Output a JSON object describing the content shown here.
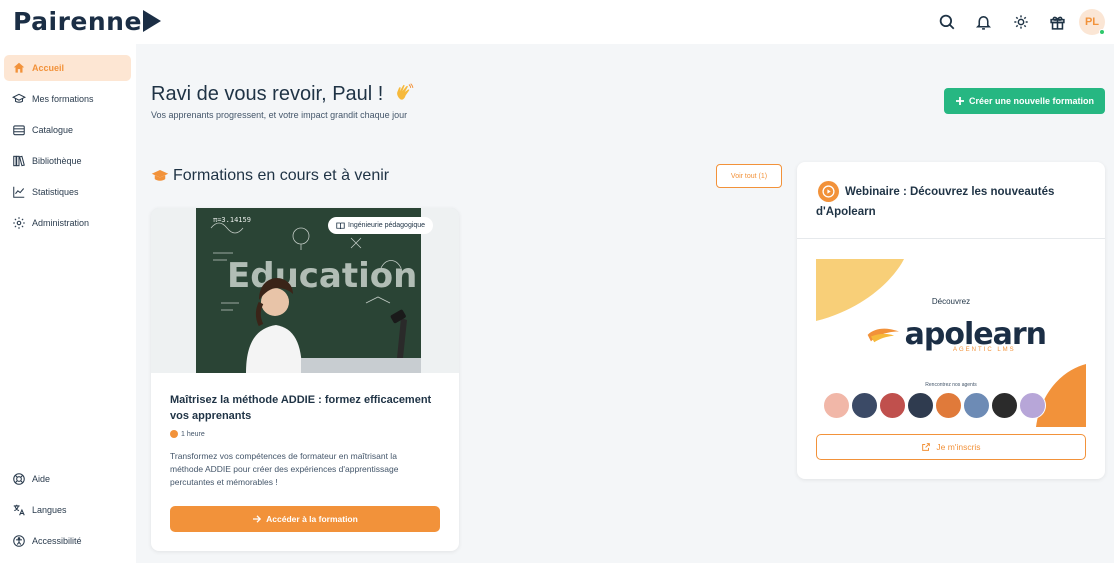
{
  "app": {
    "brand": "Pairenne"
  },
  "topbar": {
    "icons": [
      "search-icon",
      "bell-icon",
      "sun-icon",
      "gift-icon"
    ],
    "user_initials": "PL"
  },
  "sidebar": {
    "items": [
      {
        "label": "Accueil",
        "icon": "home-icon",
        "active": true
      },
      {
        "label": "Mes formations",
        "icon": "graduation-cap-icon"
      },
      {
        "label": "Catalogue",
        "icon": "catalog-icon"
      },
      {
        "label": "Bibliothèque",
        "icon": "library-icon"
      },
      {
        "label": "Statistiques",
        "icon": "chart-line-icon"
      },
      {
        "label": "Administration",
        "icon": "gear-icon"
      }
    ],
    "bottom_items": [
      {
        "label": "Aide",
        "icon": "help-icon"
      },
      {
        "label": "Langues",
        "icon": "language-icon"
      },
      {
        "label": "Accessibilité",
        "icon": "accessibility-icon"
      }
    ]
  },
  "header": {
    "welcome": "Ravi de vous revoir, Paul !",
    "subtitle": "Vos apprenants progressent, et votre impact grandit chaque jour",
    "create_button": "Créer une nouvelle formation"
  },
  "courses_section": {
    "title": "Formations en cours et à venir",
    "see_all": "Voir tout (1)",
    "course": {
      "badge": "Ingénieurie pédagogique",
      "image_text": "Education",
      "title": "Maîtrisez la méthode ADDIE : formez efficacement vos apprenants",
      "duration": "1 heure",
      "description": "Transformez vos compétences de formateur en maîtrisant la méthode ADDIE pour créer des expériences d'apprentissage percutantes et mémorables !",
      "button": "Accéder à la formation"
    }
  },
  "webinar": {
    "title": "Webinaire : Découvrez les nouveautés d'Apolearn",
    "promo": {
      "discover": "Découvrez",
      "brand": "apolearn",
      "tagline": "AGENTIC LMS",
      "meet_agents": "Rencontrez nos agents"
    },
    "register_button": "Je m'inscris"
  },
  "colors": {
    "accent": "#f2923a",
    "primary_green": "#26b782",
    "text_dark": "#1f3345"
  }
}
